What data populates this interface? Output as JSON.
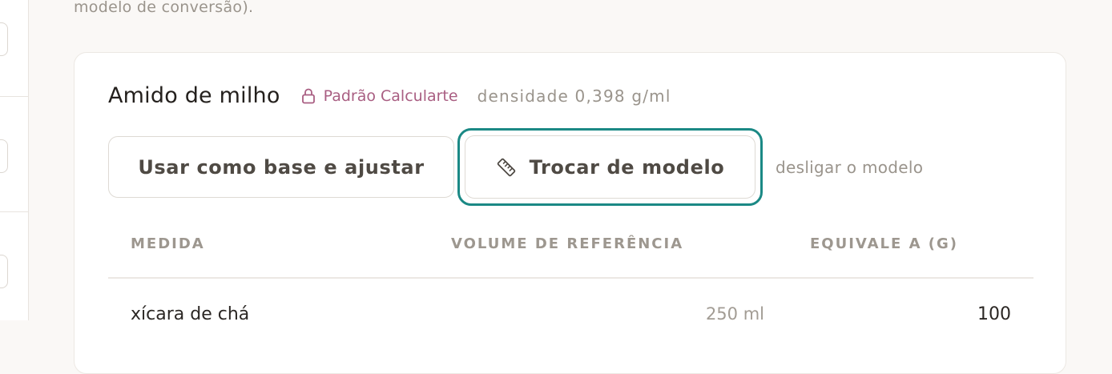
{
  "intro": {
    "text": "modelo de conversão)."
  },
  "ingredient": {
    "name": "Amido de milho",
    "badge": "Padrão Calcularte",
    "density": "densidade 0,398 g/ml"
  },
  "actions": {
    "base_label": "Usar como base e ajustar",
    "swap_label": "Trocar de modelo",
    "off_label": "desligar o modelo"
  },
  "table": {
    "headers": [
      "MEDIDA",
      "VOLUME DE REFERÊNCIA",
      "EQUIVALE A (G)"
    ],
    "rows": [
      {
        "medida": "xícara de chá",
        "volume": "250 ml",
        "equivale": "100"
      }
    ]
  },
  "colors": {
    "accent_focus": "#1b8985",
    "badge": "#a95e82",
    "muted": "#9a948c"
  },
  "icons": {
    "badge": "lock-icon",
    "swap": "ruler-icon"
  }
}
